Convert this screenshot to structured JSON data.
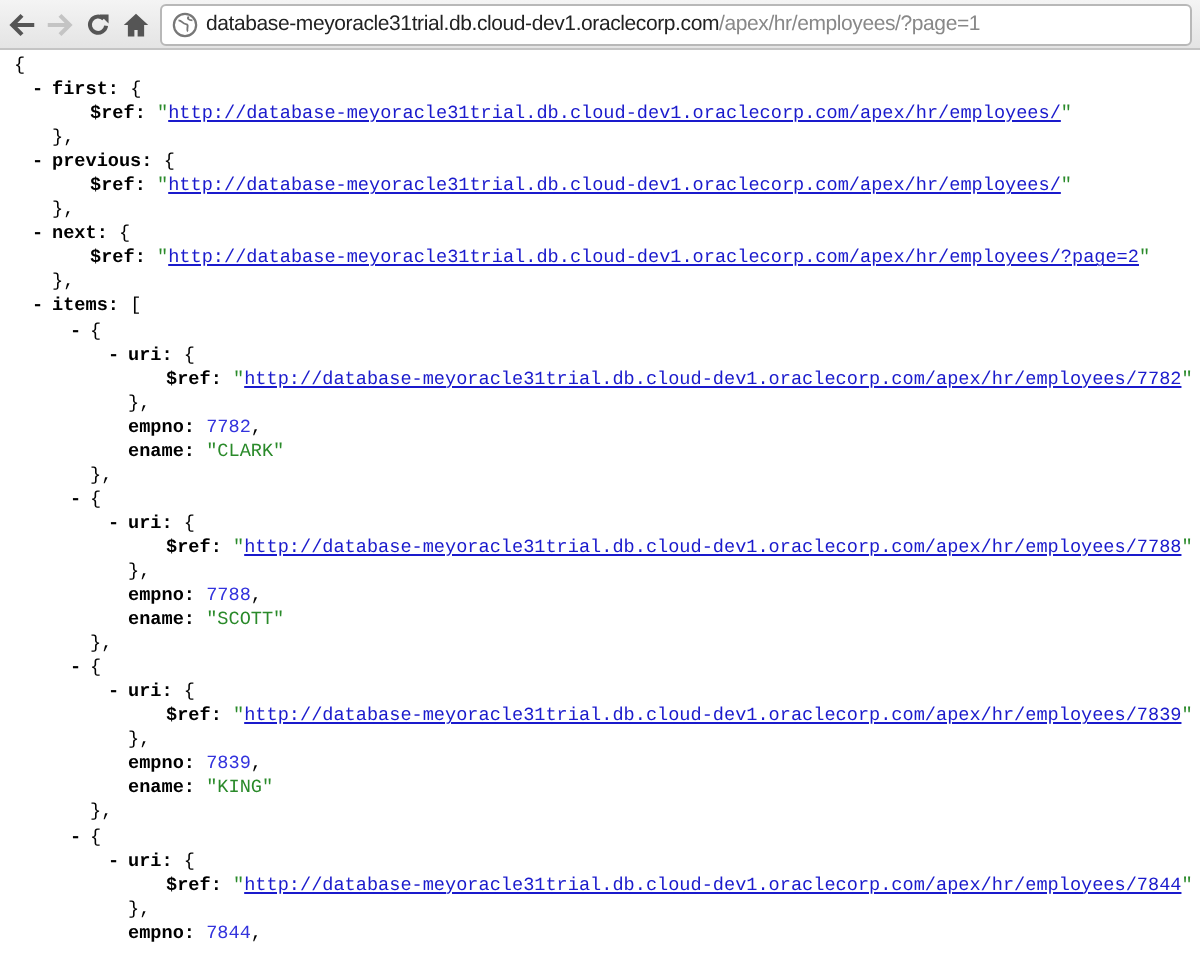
{
  "toolbar": {
    "back": {
      "disabled": false
    },
    "forward": {
      "disabled": true
    },
    "address": {
      "host": "database-meyoracle31trial.db.cloud-dev1.oraclecorp.com",
      "path": "/apex/hr/employees/?page=1"
    }
  },
  "document": {
    "kind": "object",
    "open": "{",
    "children": [
      {
        "kind": "object",
        "toggle": "-",
        "key": "first:",
        "open": "{",
        "close": "},",
        "children": [
          {
            "kind": "link",
            "key": "$ref:",
            "quote_open": "\"",
            "url": "http://database-meyoracle31trial.db.cloud-dev1.oraclecorp.com/apex/hr/employees/",
            "quote_close": "\""
          }
        ]
      },
      {
        "kind": "object",
        "toggle": "-",
        "key": "previous:",
        "open": "{",
        "close": "},",
        "children": [
          {
            "kind": "link",
            "key": "$ref:",
            "quote_open": "\"",
            "url": "http://database-meyoracle31trial.db.cloud-dev1.oraclecorp.com/apex/hr/employees/",
            "quote_close": "\""
          }
        ]
      },
      {
        "kind": "object",
        "toggle": "-",
        "key": "next:",
        "open": "{",
        "close": "},",
        "children": [
          {
            "kind": "link",
            "key": "$ref:",
            "quote_open": "\"",
            "url": "http://database-meyoracle31trial.db.cloud-dev1.oraclecorp.com/apex/hr/employees/?page=2",
            "quote_close": "\""
          }
        ]
      },
      {
        "kind": "object",
        "toggle": "-",
        "key": "items:",
        "open": "[",
        "children": [
          {
            "kind": "object",
            "toggle": "-",
            "open": "{",
            "close": "},",
            "children": [
              {
                "kind": "object",
                "toggle": "-",
                "key": "uri:",
                "open": "{",
                "close": "},",
                "children": [
                  {
                    "kind": "link",
                    "key": "$ref:",
                    "quote_open": "\"",
                    "url": "http://database-meyoracle31trial.db.cloud-dev1.oraclecorp.com/apex/hr/employees/7782",
                    "quote_close": "\""
                  }
                ]
              },
              {
                "kind": "number",
                "key": "empno:",
                "value": "7782",
                "comma": ","
              },
              {
                "kind": "string",
                "key": "ename:",
                "value": "\"CLARK\""
              }
            ]
          },
          {
            "kind": "object",
            "toggle": "-",
            "open": "{",
            "close": "},",
            "children": [
              {
                "kind": "object",
                "toggle": "-",
                "key": "uri:",
                "open": "{",
                "close": "},",
                "children": [
                  {
                    "kind": "link",
                    "key": "$ref:",
                    "quote_open": "\"",
                    "url": "http://database-meyoracle31trial.db.cloud-dev1.oraclecorp.com/apex/hr/employees/7788",
                    "quote_close": "\""
                  }
                ]
              },
              {
                "kind": "number",
                "key": "empno:",
                "value": "7788",
                "comma": ","
              },
              {
                "kind": "string",
                "key": "ename:",
                "value": "\"SCOTT\""
              }
            ]
          },
          {
            "kind": "object",
            "toggle": "-",
            "open": "{",
            "close": "},",
            "children": [
              {
                "kind": "object",
                "toggle": "-",
                "key": "uri:",
                "open": "{",
                "close": "},",
                "children": [
                  {
                    "kind": "link",
                    "key": "$ref:",
                    "quote_open": "\"",
                    "url": "http://database-meyoracle31trial.db.cloud-dev1.oraclecorp.com/apex/hr/employees/7839",
                    "quote_close": "\""
                  }
                ]
              },
              {
                "kind": "number",
                "key": "empno:",
                "value": "7839",
                "comma": ","
              },
              {
                "kind": "string",
                "key": "ename:",
                "value": "\"KING\""
              }
            ]
          },
          {
            "kind": "object",
            "toggle": "-",
            "open": "{",
            "children": [
              {
                "kind": "object",
                "toggle": "-",
                "key": "uri:",
                "open": "{",
                "close": "},",
                "children": [
                  {
                    "kind": "link",
                    "key": "$ref:",
                    "quote_open": "\"",
                    "url": "http://database-meyoracle31trial.db.cloud-dev1.oraclecorp.com/apex/hr/employees/7844",
                    "quote_close": "\""
                  }
                ]
              },
              {
                "kind": "number",
                "key": "empno:",
                "value": "7844",
                "comma": ","
              }
            ]
          }
        ]
      }
    ]
  }
}
